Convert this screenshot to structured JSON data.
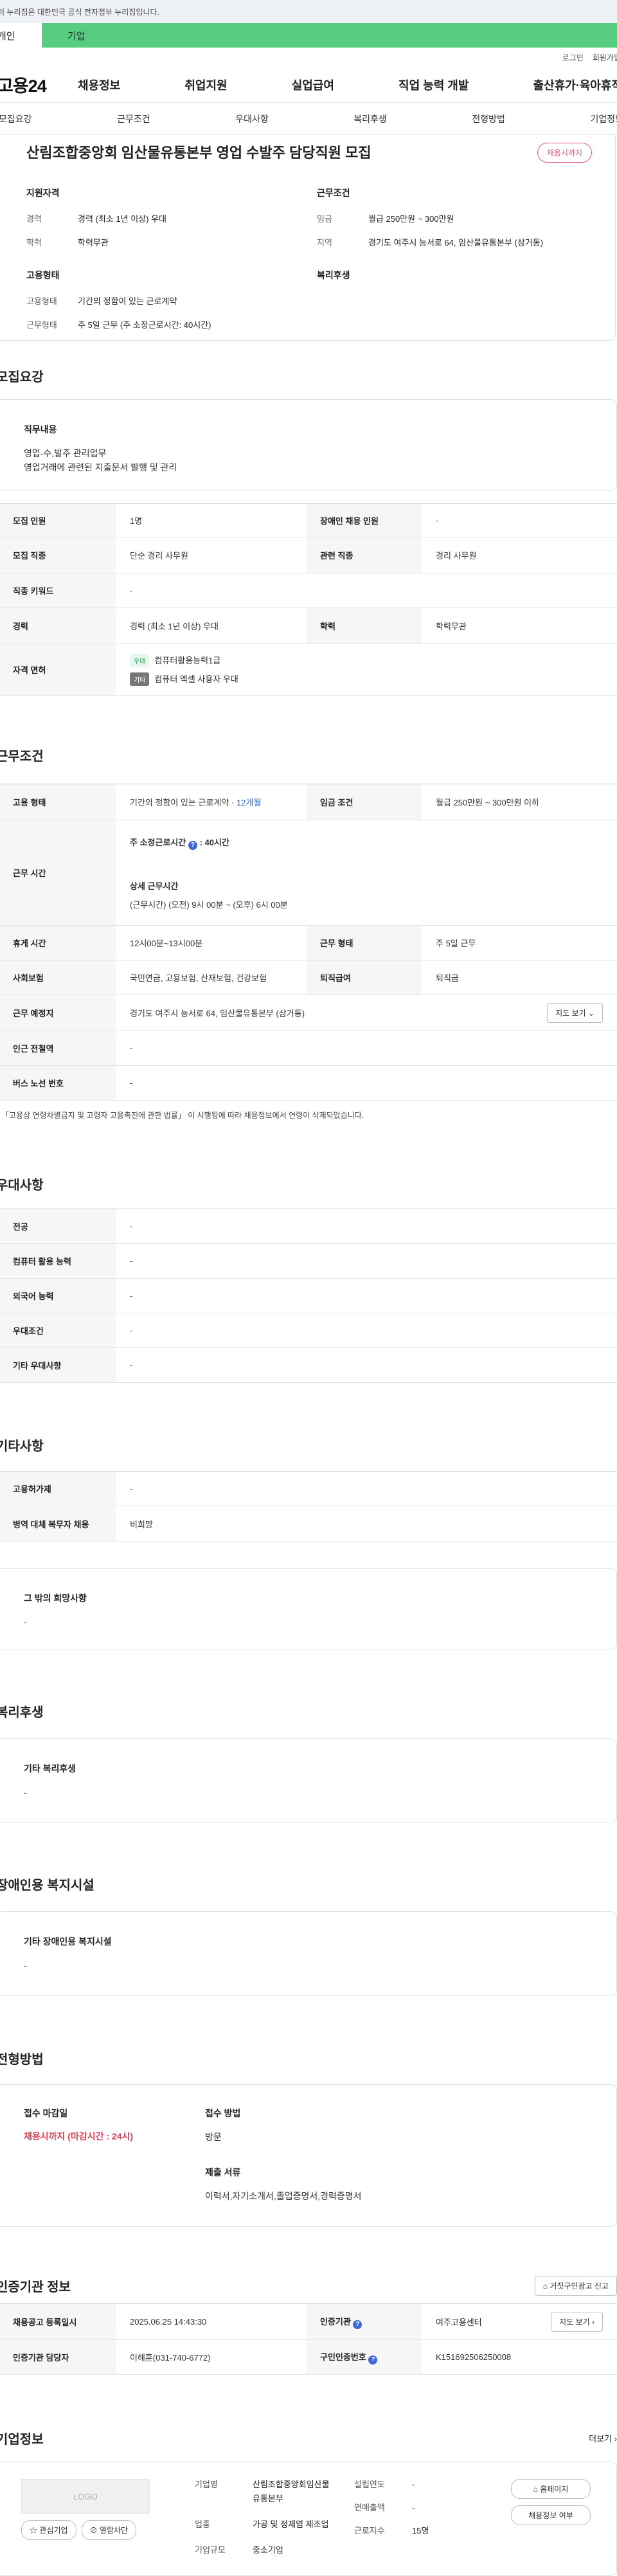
{
  "gov_banner": "이 누리집은 대한민국 공식 전자정부 누리집입니다.",
  "user_tabs": {
    "personal": "개인",
    "company": "기업"
  },
  "util": {
    "login": "로그인",
    "signup": "회원가입"
  },
  "logo": "고용24",
  "gnb": [
    "채용정보",
    "취업지원",
    "실업급여",
    "직업 능력 개발",
    "출산휴가·육아휴직"
  ],
  "anchors": [
    "모집요강",
    "근무조건",
    "우대사항",
    "복리후생",
    "전형방법",
    "기업정보"
  ],
  "summary": {
    "title": "산림조합중앙회 임산물유통본부 영업 수발주 담당직원 모집",
    "status": "채용시까지",
    "qual_head": "지원자격",
    "qual": [
      {
        "k": "경력",
        "v": "경력 (최소 1년 이상) 우대"
      },
      {
        "k": "학력",
        "v": "학력무관"
      }
    ],
    "cond_head": "근무조건",
    "cond": [
      {
        "k": "임금",
        "v": "월급 250만원 ~ 300만원"
      },
      {
        "k": "지역",
        "v": "경기도 여주시 능서로 64, 임산물유통본부 (삼거동)"
      }
    ],
    "emp_head": "고용형태",
    "emp": [
      {
        "k": "고용형태",
        "v": "기간의 정함이 있는 근로계약"
      },
      {
        "k": "근무형태",
        "v": "주 5일 근무 (주 소정근로시간: 40시간)"
      }
    ],
    "welfare_head": "복리후생"
  },
  "recruit": {
    "title": "모집요강",
    "duty_head": "직무내용",
    "duty_lines": [
      "영업-수,발주 관리업무",
      "영업거래에 관련된 지출문서 발행 및 관리"
    ],
    "rows": {
      "headcount_k": "모집 인원",
      "headcount_v": "1명",
      "disabled_k": "장애인 채용 인원",
      "disabled_v": "-",
      "job_k": "모집 직종",
      "job_v": "단순 경리 사무원",
      "related_k": "관련 직종",
      "related_v": "경리 사무원",
      "keyword_k": "직종 키워드",
      "keyword_v": "-",
      "career_k": "경력",
      "career_v": "경력 (최소 1년 이상) 우대",
      "edu_k": "학력",
      "edu_v": "학력무관",
      "license_k": "자격 면허",
      "license_tag1": "우대",
      "license_1": "컴퓨터활용능력1급",
      "license_tag2": "기타",
      "license_2": "컴퓨터 엑셀 사용자 우대"
    }
  },
  "work": {
    "title": "근무조건",
    "emp_type_k": "고용 형태",
    "emp_type_v": "기간의 정함이 있는 근로계약 · ",
    "emp_type_months": "12개월",
    "wage_k": "임금 조건",
    "wage_v": "월급 250만원 ~ 300만원 이하",
    "hours_k": "근무 시간",
    "hours_weekly_label": "주 소정근로시간",
    "hours_weekly_val": ": 40시간",
    "hours_detail_head": "상세 근무시간",
    "hours_detail": "(근무시간) (오전) 9시 00분 ~ (오후) 6시 00분",
    "break_k": "휴게 시간",
    "break_v": "12시00분~13시00분",
    "shift_k": "근무 형태",
    "shift_v": "주 5일 근무",
    "insurance_k": "사회보험",
    "insurance_v": "국민연금, 고용보험, 산재보험, 건강보험",
    "severance_k": "퇴직급여",
    "severance_v": "퇴직금",
    "place_k": "근무 예정지",
    "place_v": "경기도 여주시 능서로 64, 임산물유통본부 (삼거동)",
    "map_btn": "지도 보기",
    "subway_k": "인근 전철역",
    "subway_v": "-",
    "bus_k": "버스 노선 번호",
    "bus_v": "-",
    "note": "* 「고용상 연령차별금지 및 고령자 고용촉진에 관한 법률」 이 시행됨에 따라 채용정보에서 연령이 삭제되었습니다."
  },
  "prefer": {
    "title": "우대사항",
    "rows": [
      {
        "k": "전공",
        "v": "-"
      },
      {
        "k": "컴퓨터 활용 능력",
        "v": "-"
      },
      {
        "k": "외국어 능력",
        "v": "-"
      },
      {
        "k": "우대조건",
        "v": "-"
      },
      {
        "k": "기타 우대사항",
        "v": "-"
      }
    ]
  },
  "etc": {
    "title": "기타사항",
    "rows": [
      {
        "k": "고용허가제",
        "v": "-"
      },
      {
        "k": "병역 대체 복무자 채용",
        "v": "비희망"
      }
    ],
    "box_head": "그 밖의 희망사항",
    "box_text": "-"
  },
  "welfare": {
    "title": "복리후생",
    "box_head": "기타 복리후생",
    "box_text": "-"
  },
  "facility": {
    "title": "장애인용 복지시설",
    "box_head": "기타 장애인용 복지시설",
    "box_text": "-"
  },
  "selection": {
    "title": "전형방법",
    "deadline_head": "접수 마감일",
    "deadline_val": "채용시까지 (마감시간 : 24시)",
    "method_head": "접수 방법",
    "method_val": "방문",
    "docs_head": "제출 서류",
    "docs_val": "이력서,자기소개서,졸업증명서,경력증명서"
  },
  "agency": {
    "title": "인증기관 정보",
    "report_btn": "거짓구인광고 신고",
    "reg_k": "채용공고 등록일시",
    "reg_v": "2025.06.25 14:43:30",
    "agency_k": "인증기관",
    "agency_v": "여주고용센터",
    "map_btn": "지도 보기",
    "manager_k": "인증기관 담당자",
    "manager_v": "이해훈(031-740-6772)",
    "num_k": "구인인증번호",
    "num_v": "K151692506250008"
  },
  "company": {
    "title": "기업정보",
    "more": "더보기",
    "logo_text": "LOGO",
    "interest_btn": "관심기업",
    "block_btn": "열람차단",
    "name_k": "기업명",
    "name_v": "산림조합중앙회임산물유통본부",
    "industry_k": "업종",
    "industry_v": "가공 및 정제염 제조업",
    "scale_k": "기업규모",
    "scale_v": "중소기업",
    "founded_k": "설립연도",
    "founded_v": "-",
    "sales_k": "연매출액",
    "sales_v": "-",
    "staff_k": "근로자수",
    "staff_v": "15명",
    "homepage_btn": "홈페이지",
    "recruit_btn": "채용정보 여부"
  }
}
